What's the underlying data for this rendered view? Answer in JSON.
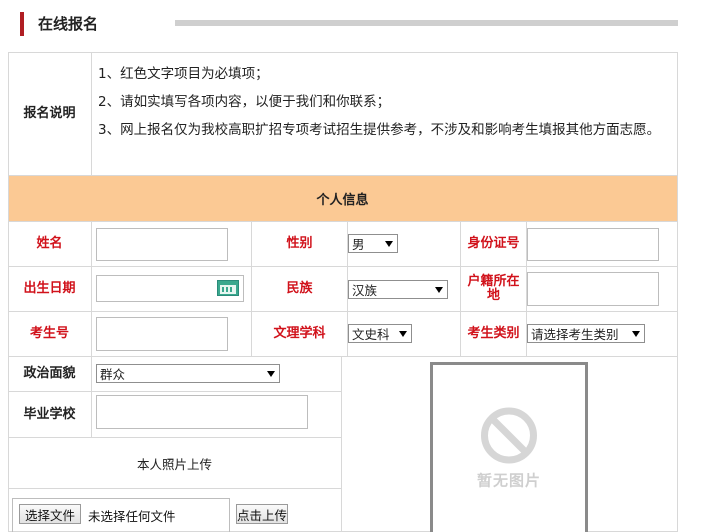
{
  "header": {
    "title": "在线报名"
  },
  "instructions": {
    "label": "报名说明",
    "lines": [
      "1、红色文字项目为必填项；",
      "2、请如实填写各项内容，以便于我们和你联系；",
      "3、网上报名仅为我校高职扩招专项考试招生提供参考，不涉及和影响考生填报其他方面志愿。"
    ]
  },
  "section": {
    "title": "个人信息"
  },
  "fields": {
    "name": {
      "label": "姓名",
      "value": ""
    },
    "gender": {
      "label": "性别",
      "value": "男"
    },
    "id_number": {
      "label": "身份证号",
      "value": ""
    },
    "birth_date": {
      "label": "出生日期",
      "value": ""
    },
    "ethnicity": {
      "label": "民族",
      "value": "汉族"
    },
    "household": {
      "label": "户籍所在地",
      "value": ""
    },
    "exam_number": {
      "label": "考生号",
      "value": ""
    },
    "subject": {
      "label": "文理学科",
      "value": "文史科"
    },
    "category": {
      "label": "考生类别",
      "value": "请选择考生类别"
    },
    "political": {
      "label": "政治面貌",
      "value": "群众"
    },
    "school": {
      "label": "毕业学校",
      "value": ""
    }
  },
  "photo": {
    "upload_label": "本人照片上传",
    "placeholder_text": "暂无图片",
    "choose_button": "选择文件",
    "no_file_text": "未选择任何文件",
    "upload_button": "点击上传"
  },
  "colors": {
    "required": "#d1121b",
    "section_bg": "#fbc994",
    "accent": "#b01e23"
  }
}
